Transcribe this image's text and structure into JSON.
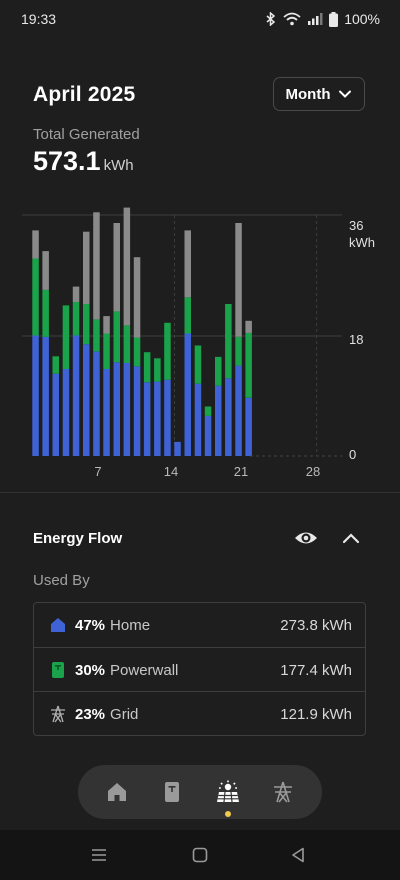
{
  "status": {
    "time": "19:33",
    "battery": "100%"
  },
  "header": {
    "title": "April 2025",
    "period_selector": "Month"
  },
  "summary": {
    "label": "Total Generated",
    "value": "573.1",
    "unit": "kWh"
  },
  "chart_data": {
    "type": "bar",
    "stacked": true,
    "x_ticks": [
      "7",
      "14",
      "21",
      "28"
    ],
    "y_ticks": [
      "0",
      "18",
      "36"
    ],
    "y_unit": "kWh",
    "ylim": [
      0,
      36
    ],
    "days": [
      1,
      2,
      3,
      4,
      5,
      6,
      7,
      8,
      9,
      10,
      11,
      12,
      13,
      14,
      15,
      16,
      17,
      18,
      19,
      20,
      21,
      22,
      23,
      24,
      25,
      26,
      27,
      28,
      29,
      30
    ],
    "series": [
      {
        "name": "Home",
        "color": "#3f63d6",
        "values": [
          18.0,
          17.8,
          12.3,
          13.0,
          18.0,
          16.7,
          15.6,
          13.0,
          14.0,
          13.9,
          13.4,
          11.0,
          11.1,
          11.4,
          2.1,
          18.3,
          10.8,
          6.0,
          10.5,
          11.6,
          13.5,
          8.7,
          0,
          0,
          0,
          0,
          0,
          0,
          0,
          0
        ]
      },
      {
        "name": "Powerwall",
        "color": "#1aa34a",
        "values": [
          11.5,
          7.0,
          2.6,
          9.5,
          5.0,
          6.0,
          4.8,
          5.3,
          7.6,
          5.6,
          4.3,
          4.5,
          3.5,
          8.5,
          0,
          5.4,
          5.7,
          1.4,
          4.3,
          11.1,
          4.3,
          9.7,
          0,
          0,
          0,
          0,
          0,
          0,
          0,
          0
        ]
      },
      {
        "name": "Grid",
        "color": "#8a8a8a",
        "values": [
          4.2,
          5.8,
          0,
          0,
          2.3,
          10.8,
          16.0,
          2.6,
          13.2,
          17.6,
          12.0,
          0,
          0,
          0,
          0,
          10.0,
          0,
          0,
          0,
          0,
          17.0,
          1.8,
          0,
          0,
          0,
          0,
          0,
          0,
          0,
          0
        ]
      }
    ]
  },
  "energy_flow": {
    "title": "Energy Flow",
    "used_by_label": "Used By",
    "rows": [
      {
        "percent": "47%",
        "label": "Home",
        "value": "273.8 kWh",
        "icon": "home-icon",
        "color": "#3f63d6"
      },
      {
        "percent": "30%",
        "label": "Powerwall",
        "value": "177.4 kWh",
        "icon": "powerwall-icon",
        "color": "#1aa34a"
      },
      {
        "percent": "23%",
        "label": "Grid",
        "value": "121.9 kWh",
        "icon": "grid-tower-icon",
        "color": "#9a9a9a"
      }
    ]
  },
  "nav": {
    "items": [
      "home",
      "powerwall",
      "solar",
      "grid"
    ],
    "active": "solar"
  }
}
